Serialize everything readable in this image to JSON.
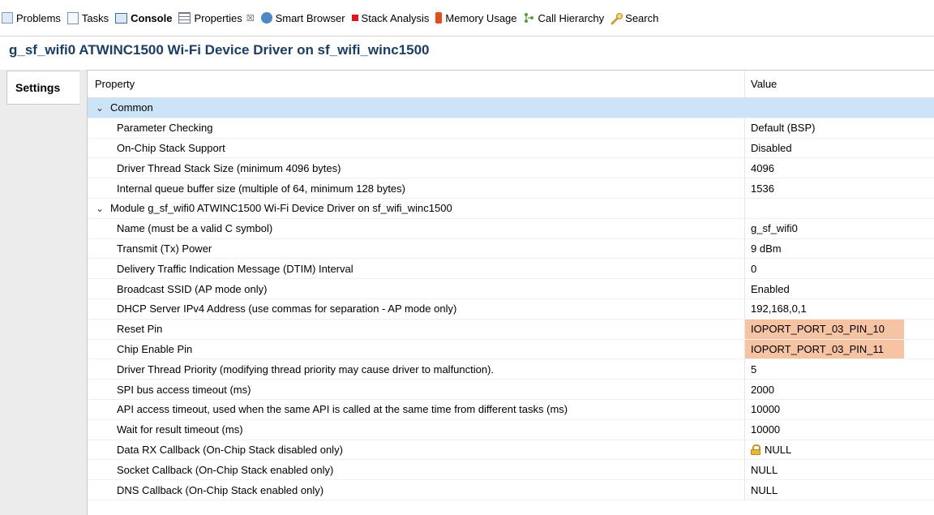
{
  "tabs": [
    {
      "label": "Problems",
      "icon": "problems-icon"
    },
    {
      "label": "Tasks",
      "icon": "tasks-icon"
    },
    {
      "label": "Console",
      "icon": "console-icon"
    },
    {
      "label": "Properties",
      "icon": "properties-icon",
      "close": "☒"
    },
    {
      "label": "Smart Browser",
      "icon": "smart-browser-icon"
    },
    {
      "label": "Stack Analysis",
      "icon": "stack-analysis-icon"
    },
    {
      "label": "Memory Usage",
      "icon": "memory-usage-icon"
    },
    {
      "label": "Call Hierarchy",
      "icon": "call-hierarchy-icon"
    },
    {
      "label": "Search",
      "icon": "search-icon"
    }
  ],
  "title": "g_sf_wifi0 ATWINC1500 Wi-Fi Device Driver on sf_wifi_winc1500",
  "settings_tab": "Settings",
  "table": {
    "header_property": "Property",
    "header_value": "Value",
    "rows": [
      {
        "label": "Common",
        "value": "",
        "group": true
      },
      {
        "label": "Parameter Checking",
        "value": "Default (BSP)"
      },
      {
        "label": "On-Chip Stack Support",
        "value": "Disabled"
      },
      {
        "label": "Driver Thread Stack Size (minimum 4096 bytes)",
        "value": "4096"
      },
      {
        "label": "Internal queue buffer size (multiple of 64, minimum 128 bytes)",
        "value": "1536"
      },
      {
        "label": "Module g_sf_wifi0 ATWINC1500 Wi-Fi Device Driver on sf_wifi_winc1500",
        "value": "",
        "group": true
      },
      {
        "label": "Name (must be a valid C symbol)",
        "value": "g_sf_wifi0"
      },
      {
        "label": "Transmit (Tx) Power",
        "value": "9 dBm"
      },
      {
        "label": "Delivery Traffic Indication Message (DTIM) Interval",
        "value": "0"
      },
      {
        "label": "Broadcast SSID (AP mode only)",
        "value": "Enabled"
      },
      {
        "label": "DHCP Server IPv4 Address (use commas for separation - AP mode only)",
        "value": "192,168,0,1"
      },
      {
        "label": "Reset Pin",
        "value": "IOPORT_PORT_03_PIN_10",
        "error": true
      },
      {
        "label": "Chip Enable Pin",
        "value": "IOPORT_PORT_03_PIN_11",
        "error": true
      },
      {
        "label": "Driver Thread Priority (modifying thread priority may cause driver to malfunction).",
        "value": "5"
      },
      {
        "label": "SPI bus access timeout (ms)",
        "value": "2000"
      },
      {
        "label": "API access timeout, used when the same API is called at the same time from different tasks (ms)",
        "value": "10000"
      },
      {
        "label": "Wait for result timeout (ms)",
        "value": "10000"
      },
      {
        "label": "Data RX Callback (On-Chip Stack disabled only)",
        "value": "NULL",
        "locked": true
      },
      {
        "label": "Socket Callback (On-Chip Stack enabled only)",
        "value": "NULL"
      },
      {
        "label": "DNS Callback (On-Chip Stack enabled only)",
        "value": "NULL"
      }
    ]
  },
  "colors": {
    "title": "#1b3e66",
    "selected_row": "#cce4f7",
    "error_value": "#f7c4a3"
  }
}
